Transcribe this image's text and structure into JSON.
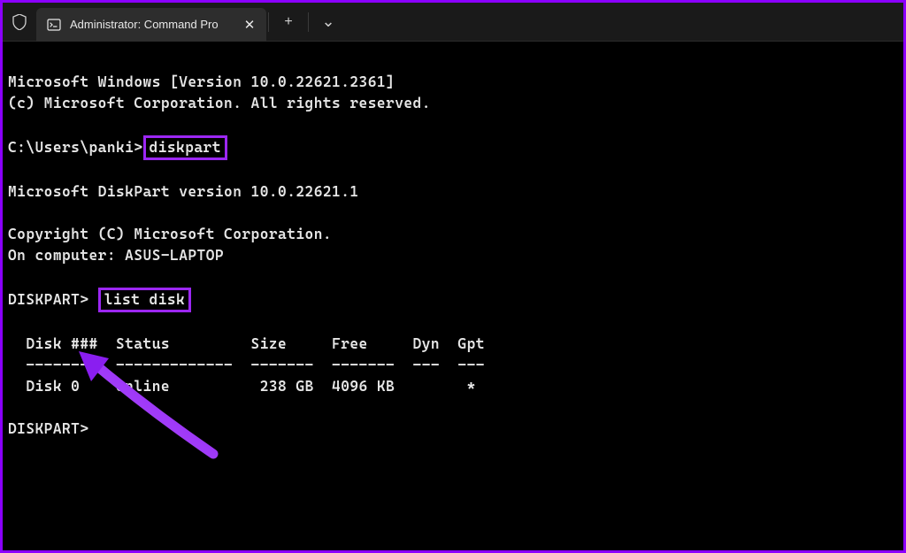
{
  "titlebar": {
    "tab_title": "Administrator: Command Pro",
    "close_glyph": "✕",
    "new_tab_glyph": "+",
    "dropdown_glyph": "⌄"
  },
  "terminal": {
    "line1": "Microsoft Windows [Version 10.0.22621.2361]",
    "line2": "(c) Microsoft Corporation. All rights reserved.",
    "prompt1_prefix": "C:\\Users\\panki>",
    "command1": "diskpart",
    "line_diskpart_ver": "Microsoft DiskPart version 10.0.22621.1",
    "line_copyright": "Copyright (C) Microsoft Corporation.",
    "line_computer": "On computer: ASUS-LAPTOP",
    "prompt2_prefix": "DISKPART> ",
    "command2": "list disk",
    "table_header": "  Disk ###  Status         Size     Free     Dyn  Gpt",
    "table_divider": "  --------  -------------  -------  -------  ---  ---",
    "table_row1": "  Disk 0    Online          238 GB  4096 KB        *",
    "prompt3": "DISKPART>"
  },
  "colors": {
    "highlight": "#9c27f5",
    "border": "#8b00ff"
  }
}
